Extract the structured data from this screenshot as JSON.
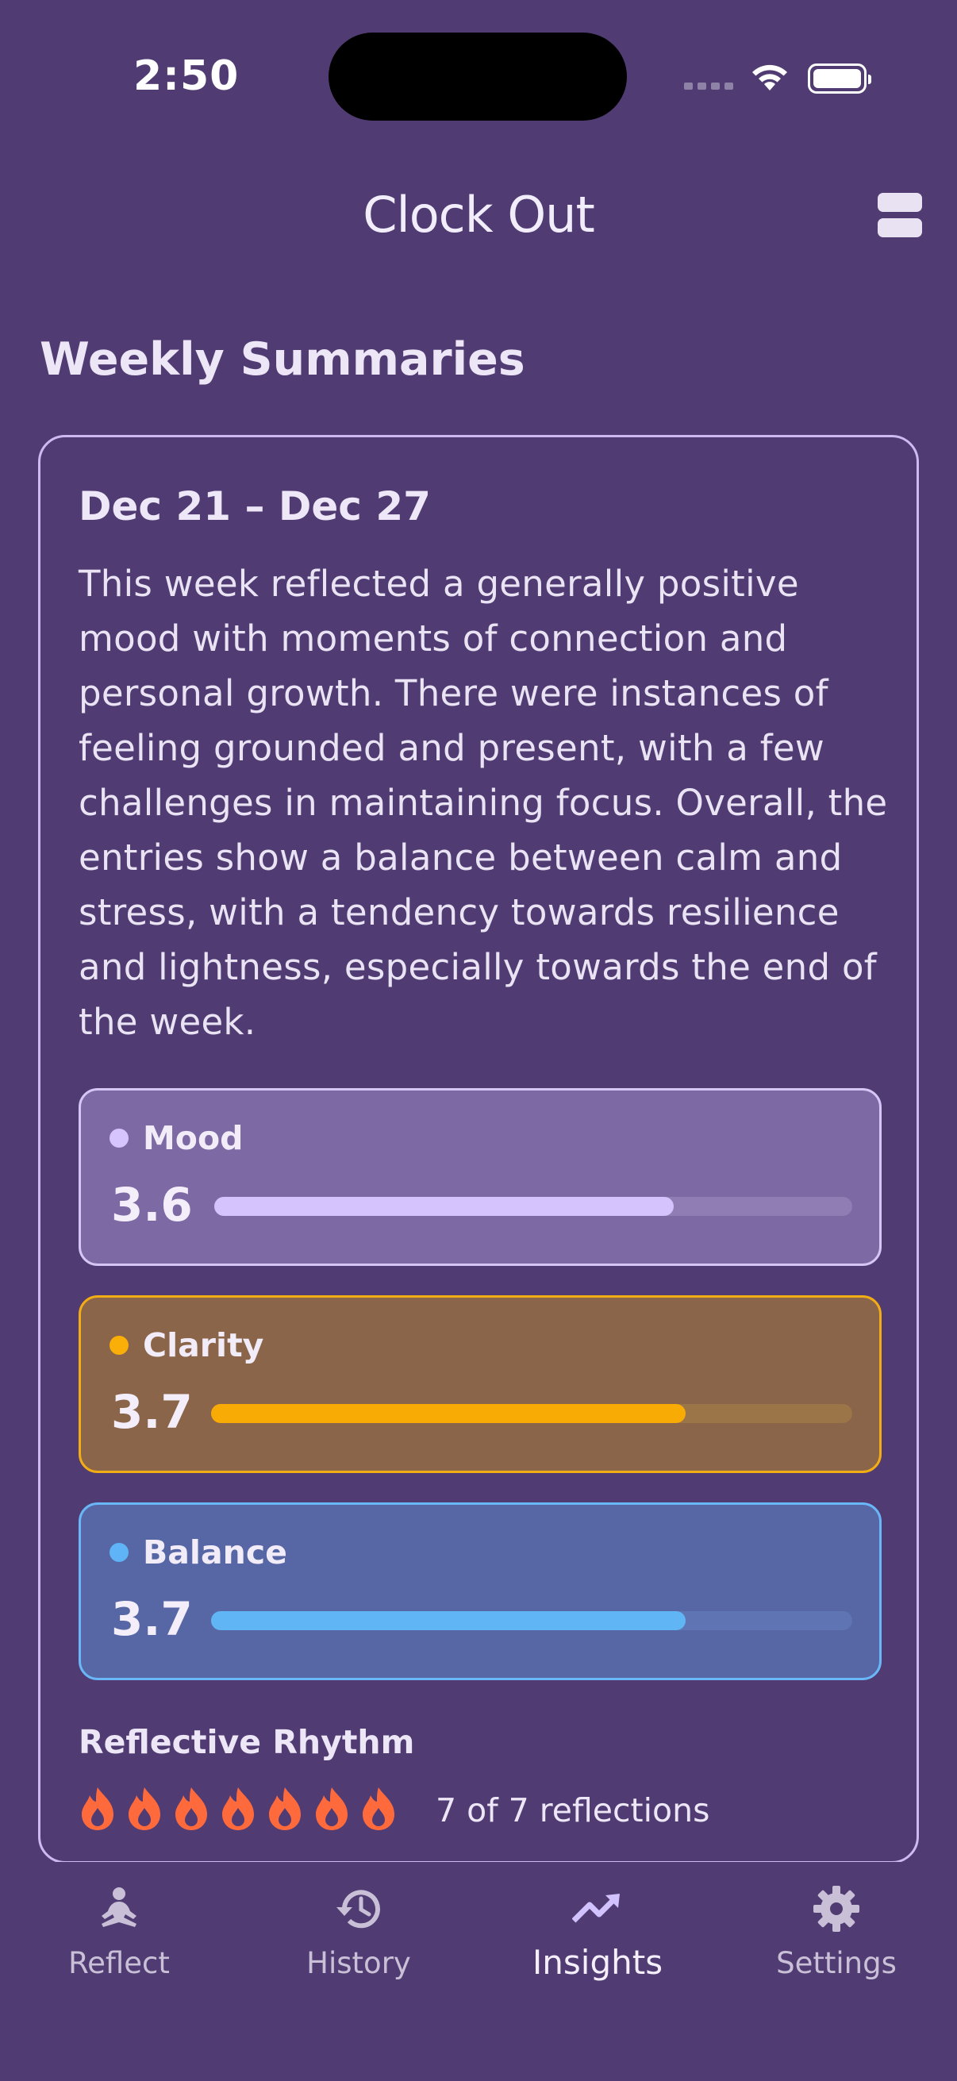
{
  "status_bar": {
    "time": "2:50"
  },
  "header": {
    "title": "Clock Out"
  },
  "section": {
    "title": "Weekly Summaries"
  },
  "summary_card": {
    "date_range": "Dec 21 – Dec 27",
    "text": "This week reflected a generally positive mood with moments of connection and personal growth. There were instances of feeling grounded and present, with a few challenges in maintaining focus. Overall, the entries show a balance between calm and stress, with a tendency towards resilience and lightness, especially towards the end of the week.",
    "metrics": [
      {
        "label": "Mood",
        "value": "3.6",
        "fraction": 0.72,
        "color": "#d6c4ff"
      },
      {
        "label": "Clarity",
        "value": "3.7",
        "fraction": 0.74,
        "color": "#f9ae08"
      },
      {
        "label": "Balance",
        "value": "3.7",
        "fraction": 0.74,
        "color": "#5fb4f7"
      }
    ],
    "rhythm": {
      "title": "Reflective Rhythm",
      "count_text": "7 of 7 reflections",
      "completed": 7,
      "total": 7,
      "icon": "flame-icon",
      "icon_color": "#ff6a3d"
    }
  },
  "nav": {
    "items": [
      {
        "label": "Reflect",
        "icon": "meditation-icon",
        "active": false
      },
      {
        "label": "History",
        "icon": "history-icon",
        "active": false
      },
      {
        "label": "Insights",
        "icon": "trending-up-icon",
        "active": true
      },
      {
        "label": "Settings",
        "icon": "gear-icon",
        "active": false
      }
    ]
  }
}
